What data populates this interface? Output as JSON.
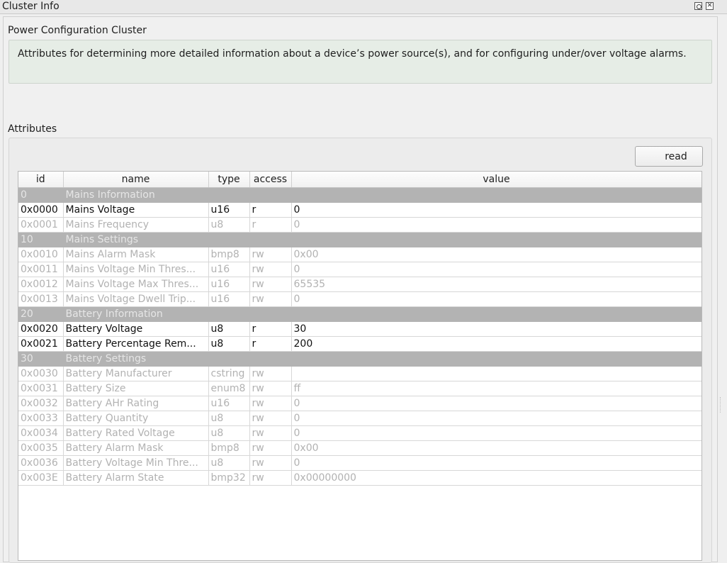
{
  "window": {
    "title": "Cluster Info"
  },
  "cluster": {
    "name": "Power Configuration Cluster",
    "description": "Attributes for determining more detailed information about a device’s power source(s), and for configuring under/over voltage alarms."
  },
  "attributes": {
    "label": "Attributes",
    "read_button": "read",
    "columns": [
      "id",
      "name",
      "type",
      "access",
      "value"
    ],
    "rows": [
      {
        "kind": "group",
        "id": "0",
        "name": "Mains Information"
      },
      {
        "kind": "active",
        "id": "0x0000",
        "name": "Mains Voltage",
        "type": "u16",
        "access": "r",
        "value": "0"
      },
      {
        "kind": "inactive",
        "id": "0x0001",
        "name": "Mains Frequency",
        "type": "u8",
        "access": "r",
        "value": "0"
      },
      {
        "kind": "group",
        "id": "10",
        "name": "Mains Settings"
      },
      {
        "kind": "inactive",
        "id": "0x0010",
        "name": "Mains Alarm Mask",
        "type": "bmp8",
        "access": "rw",
        "value": "0x00"
      },
      {
        "kind": "inactive",
        "id": "0x0011",
        "name": "Mains Voltage Min Thres...",
        "type": "u16",
        "access": "rw",
        "value": "0"
      },
      {
        "kind": "inactive",
        "id": "0x0012",
        "name": "Mains Voltage Max Thres...",
        "type": "u16",
        "access": "rw",
        "value": "65535"
      },
      {
        "kind": "inactive",
        "id": "0x0013",
        "name": "Mains Voltage Dwell Trip...",
        "type": "u16",
        "access": "rw",
        "value": "0"
      },
      {
        "kind": "group",
        "id": "20",
        "name": "Battery Information"
      },
      {
        "kind": "active",
        "id": "0x0020",
        "name": "Battery Voltage",
        "type": "u8",
        "access": "r",
        "value": "30"
      },
      {
        "kind": "active",
        "id": "0x0021",
        "name": "Battery Percentage Rem...",
        "type": "u8",
        "access": "r",
        "value": "200"
      },
      {
        "kind": "group",
        "id": "30",
        "name": "Battery Settings"
      },
      {
        "kind": "inactive",
        "id": "0x0030",
        "name": "Battery Manufacturer",
        "type": "cstring",
        "access": "rw",
        "value": ""
      },
      {
        "kind": "inactive",
        "id": "0x0031",
        "name": "Battery Size",
        "type": "enum8",
        "access": "rw",
        "value": "ff"
      },
      {
        "kind": "inactive",
        "id": "0x0032",
        "name": "Battery AHr Rating",
        "type": "u16",
        "access": "rw",
        "value": "0"
      },
      {
        "kind": "inactive",
        "id": "0x0033",
        "name": "Battery Quantity",
        "type": "u8",
        "access": "rw",
        "value": "0"
      },
      {
        "kind": "inactive",
        "id": "0x0034",
        "name": "Battery Rated Voltage",
        "type": "u8",
        "access": "rw",
        "value": "0"
      },
      {
        "kind": "inactive",
        "id": "0x0035",
        "name": "Battery Alarm Mask",
        "type": "bmp8",
        "access": "rw",
        "value": "0x00"
      },
      {
        "kind": "inactive",
        "id": "0x0036",
        "name": "Battery Voltage Min Thre...",
        "type": "u8",
        "access": "rw",
        "value": "0"
      },
      {
        "kind": "inactive",
        "id": "0x003E",
        "name": "Battery Alarm State",
        "type": "bmp32",
        "access": "rw",
        "value": "0x00000000"
      }
    ]
  },
  "icons": {
    "float": "float-window-icon",
    "close": "close-window-icon"
  }
}
